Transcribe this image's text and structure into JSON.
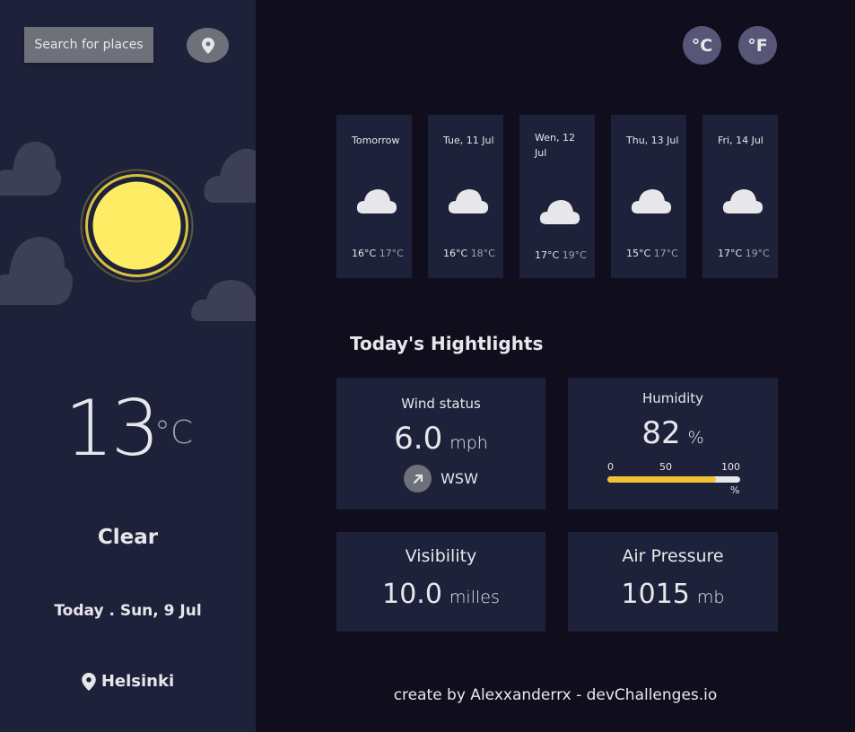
{
  "sidebar": {
    "search_label": "Search for places",
    "current": {
      "temperature": "13",
      "unit": "°C",
      "state": "Clear",
      "date": "Today . Sun, 9 Jul",
      "location": "Helsinki"
    }
  },
  "units": {
    "celsius": "°C",
    "fahrenheit": "°F"
  },
  "forecast": [
    {
      "day": "Tomorrow",
      "max": "16°C",
      "min": "17°C"
    },
    {
      "day": "Tue, 11 Jul",
      "max": "16°C",
      "min": "18°C"
    },
    {
      "day": "Wen, 12 Jul",
      "max": "17°C",
      "min": "19°C"
    },
    {
      "day": "Thu, 13 Jul",
      "max": "15°C",
      "min": "17°C"
    },
    {
      "day": "Fri, 14 Jul",
      "max": "17°C",
      "min": "19°C"
    }
  ],
  "highlights": {
    "title": "Today's Hightlights",
    "wind": {
      "label": "Wind status",
      "value": "6.0",
      "unit": "mph",
      "direction": "WSW"
    },
    "humidity": {
      "label": "Humidity",
      "value": "82",
      "unit": "%",
      "scale_0": "0",
      "scale_50": "50",
      "scale_100": "100",
      "scale_pct": "%",
      "fill_fraction": 0.82
    },
    "visibility": {
      "label": "Visibility",
      "value": "10.0",
      "unit": "milles"
    },
    "pressure": {
      "label": "Air Pressure",
      "value": "1015",
      "unit": "mb"
    }
  },
  "footer": "create by Alexxanderrx - devChallenges.io",
  "colors": {
    "sidebar_bg": "#1e213a",
    "main_bg": "#100e1d",
    "sun": "#ffec65",
    "humidity_bar": "#f1c232",
    "unit_button": "#585676"
  },
  "icons": {
    "locate": "location-crosshair-icon",
    "pin": "map-pin-icon",
    "wind_arrow": "navigation-arrow-icon",
    "weather_main": "sun-icon",
    "forecast": "cloud-icon"
  }
}
